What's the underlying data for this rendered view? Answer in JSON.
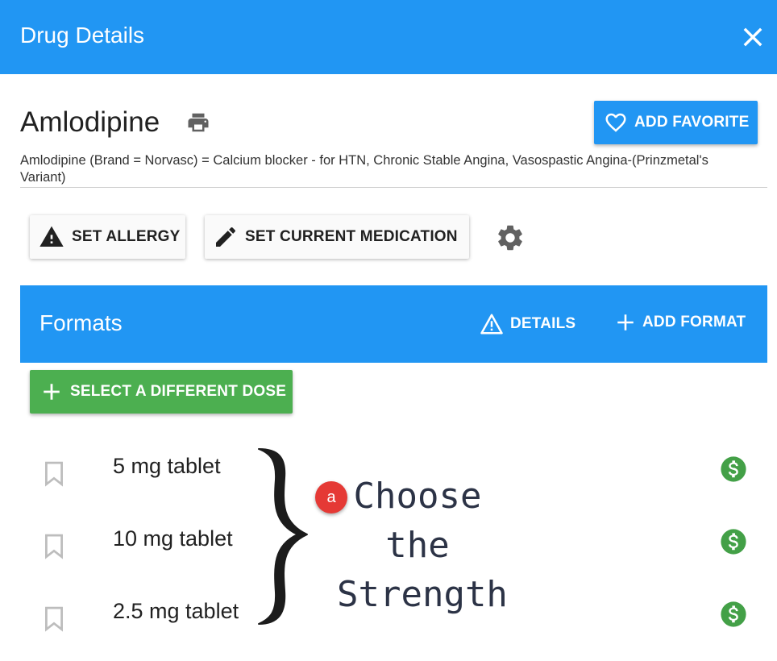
{
  "header": {
    "title": "Drug Details",
    "close_icon": "close-icon"
  },
  "drug": {
    "name": "Amlodipine",
    "description": "Amlodipine (Brand = Norvasc) = Calcium blocker - for HTN, Chronic Stable Angina, Vasospastic Angina-(Prinzmetal's Variant)",
    "print_icon": "print-icon"
  },
  "favorite_button": {
    "label": "ADD FAVORITE",
    "icon": "heart-outline-icon"
  },
  "actions": {
    "allergy_label": "SET ALLERGY",
    "medication_label": "SET CURRENT MEDICATION",
    "settings_icon": "gear-icon"
  },
  "formats": {
    "title": "Formats",
    "details_label": "DETAILS",
    "add_format_label": "ADD FORMAT"
  },
  "dose_button": {
    "label": "SELECT A DIFFERENT DOSE"
  },
  "doses": [
    {
      "label": "5 mg tablet",
      "price_icon": "dollar-icon"
    },
    {
      "label": "10 mg tablet",
      "price_icon": "dollar-icon"
    },
    {
      "label": "2.5 mg tablet",
      "price_icon": "dollar-icon"
    }
  ],
  "annotation": {
    "badge": "a",
    "lines": [
      "Choose",
      "the",
      "Strength"
    ]
  },
  "colors": {
    "primary": "#2196f3",
    "success": "#4caf50",
    "badge": "#e53935"
  }
}
